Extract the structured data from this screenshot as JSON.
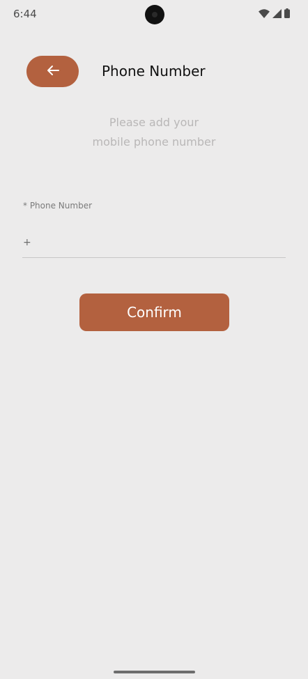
{
  "status_bar": {
    "time": "6:44",
    "icons": [
      "wifi-icon",
      "signal-icon",
      "battery-icon"
    ]
  },
  "header": {
    "back_icon": "arrow-left-icon",
    "title": "Phone Number"
  },
  "intro": {
    "line1": "Please add your",
    "line2": "mobile phone number"
  },
  "form": {
    "phone_label": "* Phone Number",
    "phone_prefix": "+",
    "phone_value": "",
    "phone_placeholder": ""
  },
  "actions": {
    "confirm_label": "Confirm"
  },
  "colors": {
    "accent": "#b3613f",
    "background": "#ecebeb",
    "subtitle": "#b9b7b7"
  }
}
